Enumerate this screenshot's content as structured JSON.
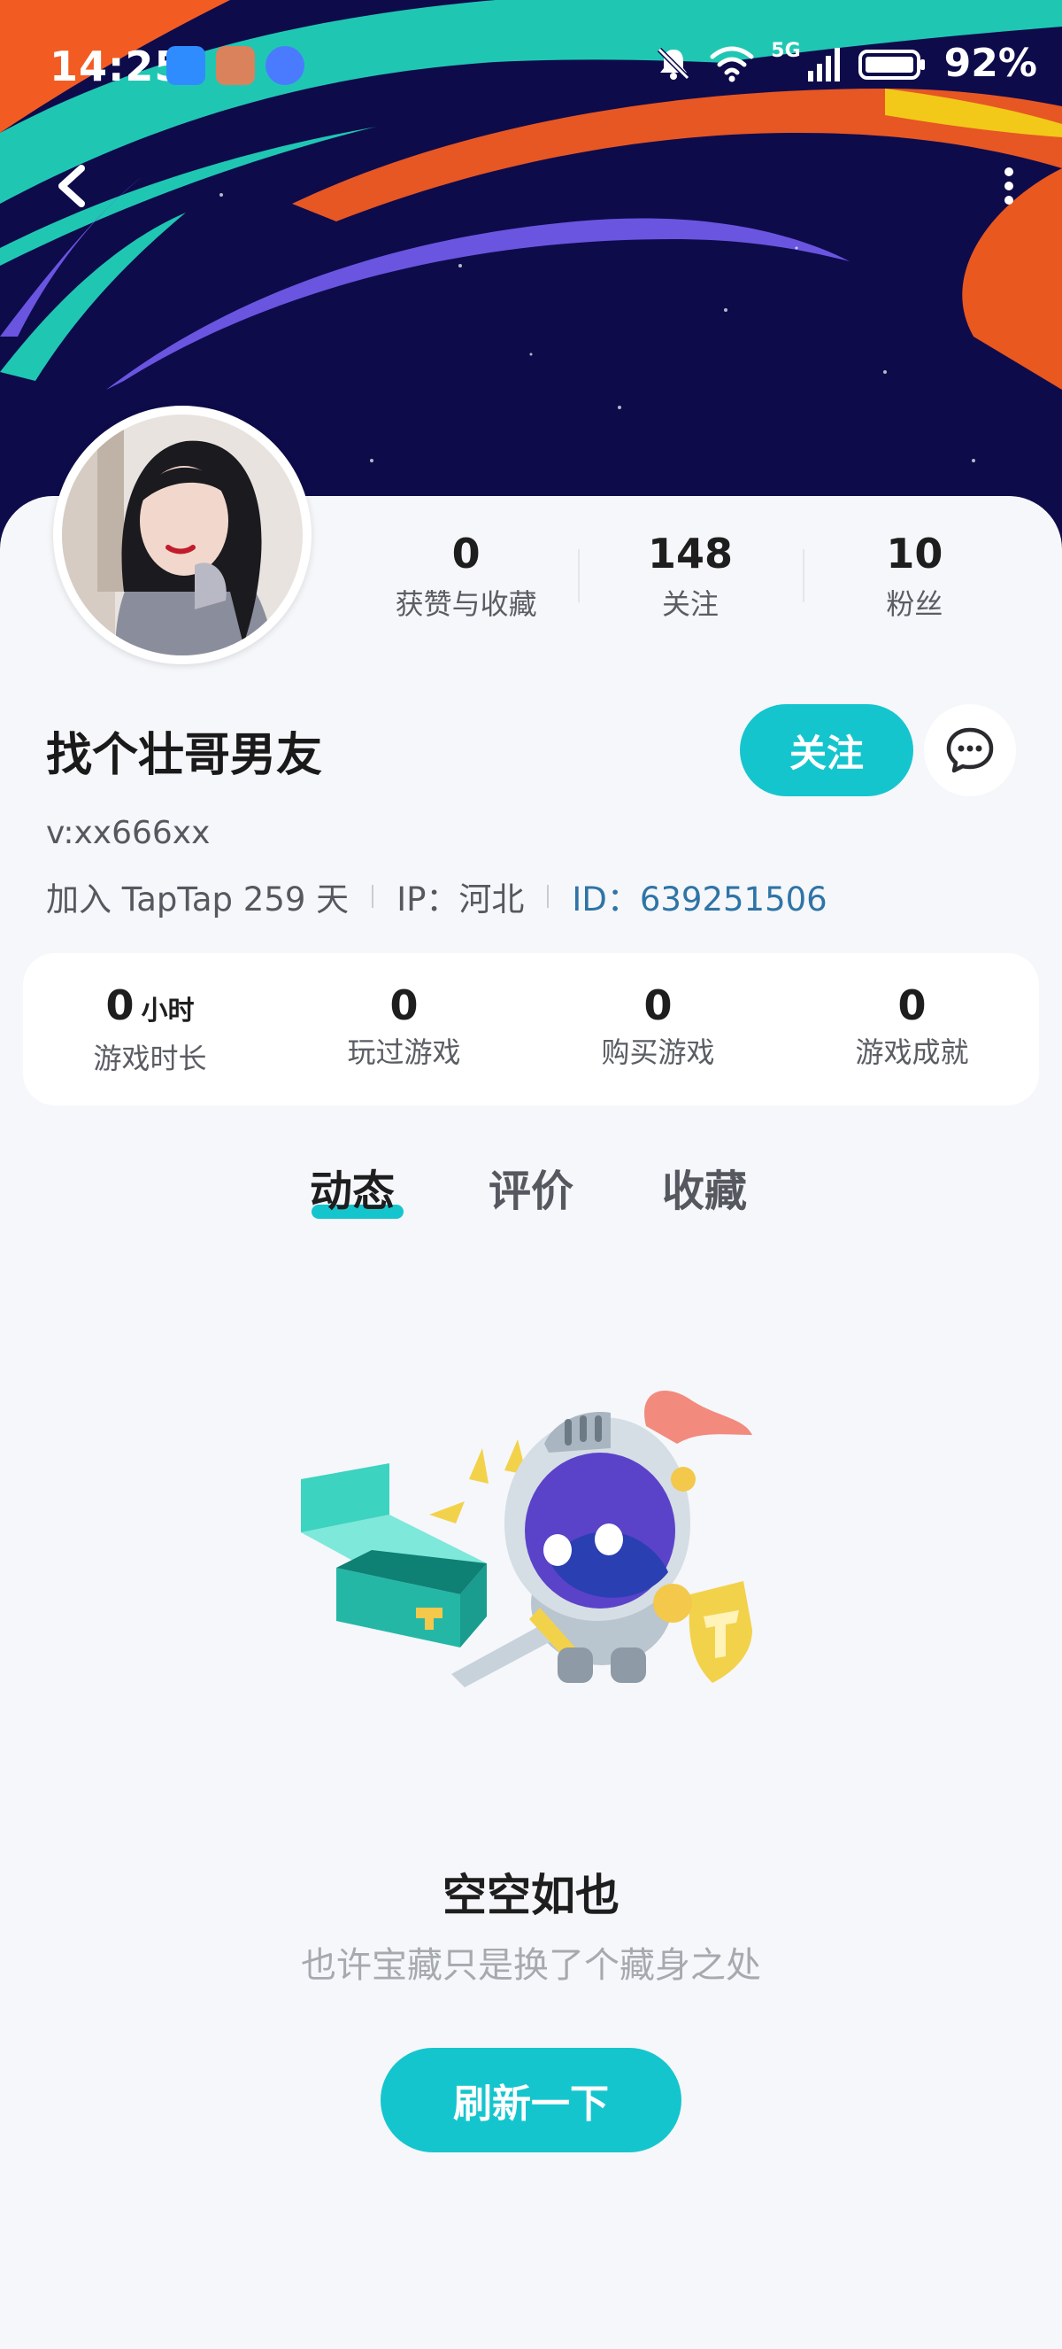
{
  "status_bar": {
    "time": "14:25",
    "battery": "92%",
    "network": "5G"
  },
  "profile": {
    "stats": [
      {
        "value": "0",
        "label": "获赞与收藏"
      },
      {
        "value": "148",
        "label": "关注"
      },
      {
        "value": "10",
        "label": "粉丝"
      }
    ],
    "nickname": "找个壮哥男友",
    "follow_label": "关注",
    "contact": "v:xx666xx",
    "joined": "加入 TapTap 259 天",
    "ip": "IP：河北",
    "id": "ID：639251506"
  },
  "game_stats": [
    {
      "value": "0",
      "unit": "小时",
      "label": "游戏时长"
    },
    {
      "value": "0",
      "unit": "",
      "label": "玩过游戏"
    },
    {
      "value": "0",
      "unit": "",
      "label": "购买游戏"
    },
    {
      "value": "0",
      "unit": "",
      "label": "游戏成就"
    }
  ],
  "tabs": [
    {
      "label": "动态",
      "active": true
    },
    {
      "label": "评价",
      "active": false
    },
    {
      "label": "收藏",
      "active": false
    }
  ],
  "empty_state": {
    "title": "空空如也",
    "subtitle": "也许宝藏只是换了个藏身之处",
    "refresh_label": "刷新一下"
  },
  "colors": {
    "accent": "#15c5ce",
    "id_link": "#2f74a6",
    "banner_bg": "#0e0b4b",
    "banner_orange": "#f25c22",
    "banner_purple": "#6a55e0",
    "banner_teal": "#1fc7b3"
  },
  "icons": [
    "back-icon",
    "more-icon",
    "message-icon",
    "mute-icon",
    "wifi-icon",
    "signal-icon",
    "battery-icon"
  ]
}
